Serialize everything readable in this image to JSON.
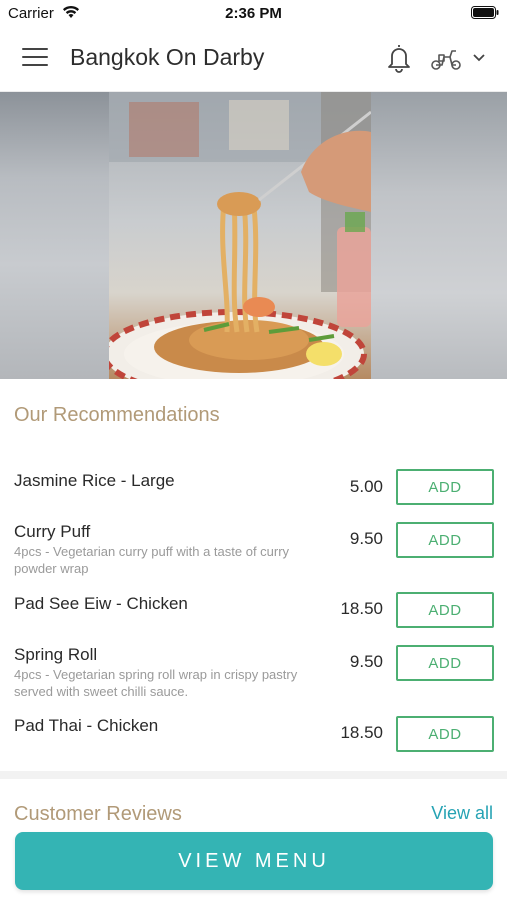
{
  "status_bar": {
    "carrier": "Carrier",
    "time": "2:36 PM"
  },
  "header": {
    "title": "Bangkok On Darby",
    "icons": [
      "menu-icon",
      "bell-icon",
      "scooter-icon",
      "chevron-down-icon"
    ]
  },
  "recommendations": {
    "title": "Our Recommendations",
    "items": [
      {
        "name": "Jasmine Rice - Large",
        "description": "",
        "price": "5.00",
        "add_label": "ADD"
      },
      {
        "name": "Curry Puff",
        "description": "4pcs - Vegetarian curry puff with a taste of curry powder wrap",
        "price": "9.50",
        "add_label": "ADD"
      },
      {
        "name": "Pad See Eiw - Chicken",
        "description": "",
        "price": "18.50",
        "add_label": "ADD"
      },
      {
        "name": "Spring Roll",
        "description": "4pcs - Vegetarian spring roll wrap in crispy pastry served with sweet chilli sauce.",
        "price": "9.50",
        "add_label": "ADD"
      },
      {
        "name": "Pad Thai - Chicken",
        "description": "",
        "price": "18.50",
        "add_label": "ADD"
      }
    ]
  },
  "reviews": {
    "title": "Customer Reviews",
    "view_all_label": "View all"
  },
  "footer": {
    "view_menu_label": "VIEW MENU"
  },
  "colors": {
    "accent_teal": "#34b4b4",
    "add_green": "#4caf72",
    "section_title_tan": "#b19a78",
    "link_teal": "#26a3b4"
  }
}
